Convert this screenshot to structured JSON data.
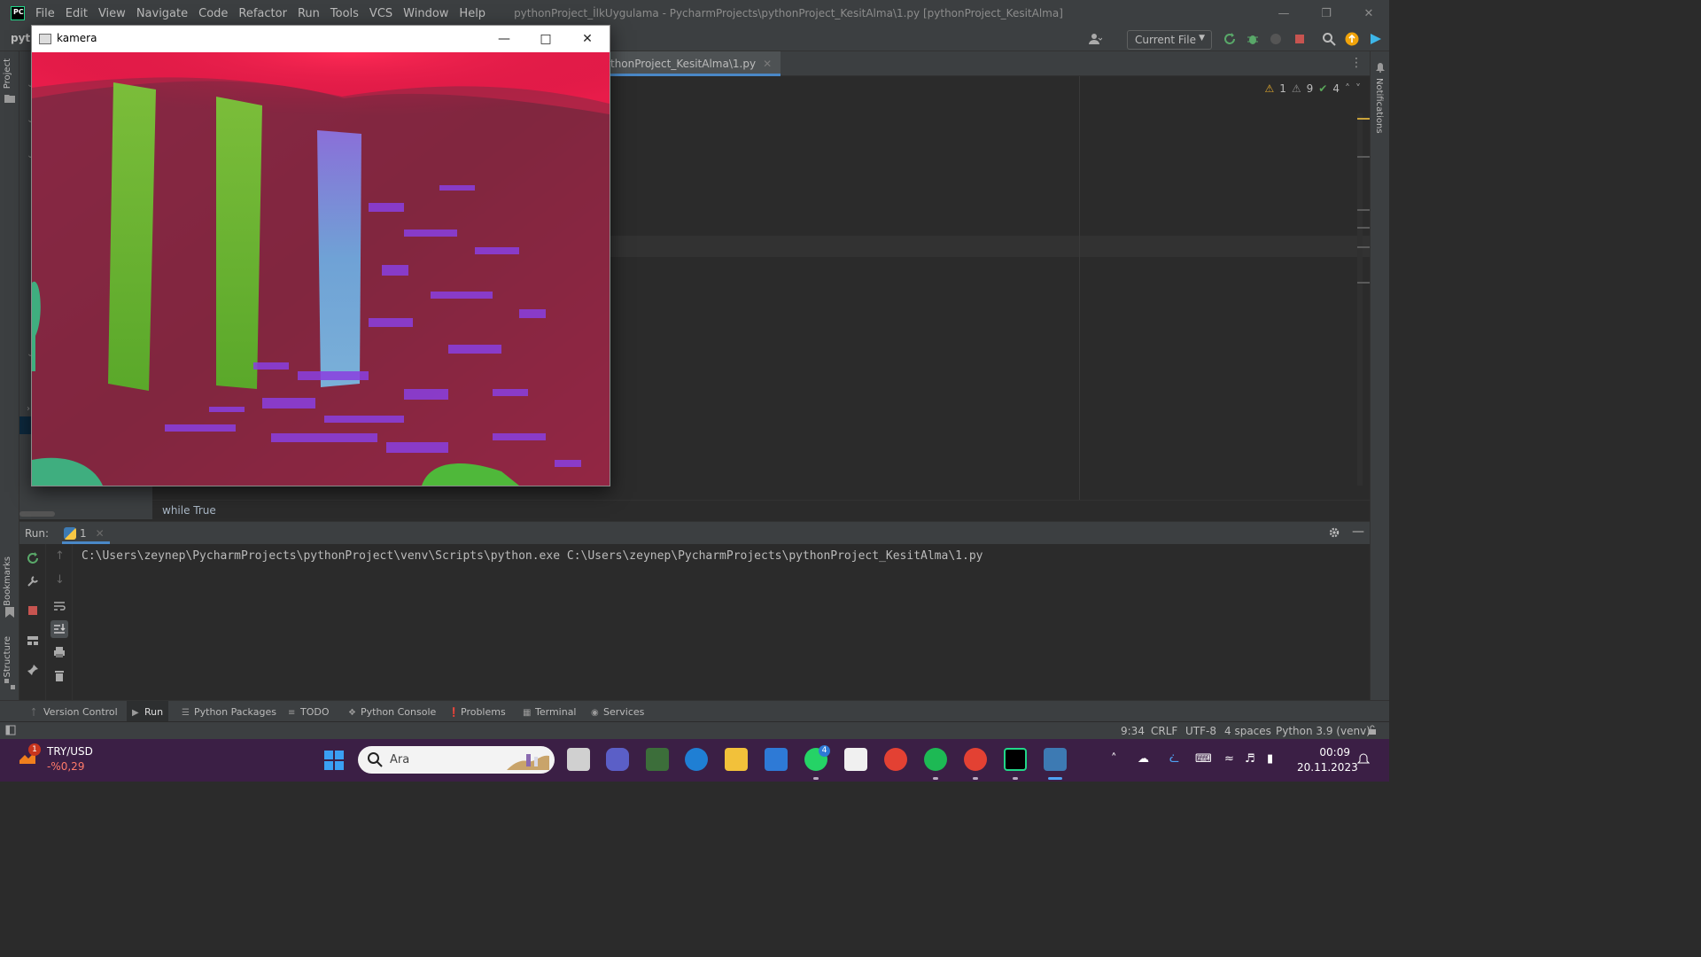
{
  "menu": [
    "File",
    "Edit",
    "View",
    "Navigate",
    "Code",
    "Refactor",
    "Run",
    "Tools",
    "VCS",
    "Window",
    "Help"
  ],
  "window_title": "pythonProject_İlkUygulama - PycharmProjects\\pythonProject_KesitAlma\\1.py [pythonProject_KesitAlma]",
  "project_crumb": "pyth",
  "run_config": "Current File",
  "left_strip": {
    "project": "Project",
    "bookmarks": "Bookmarks",
    "structure": "Structure"
  },
  "right_strip": {
    "notifications": "Notifications"
  },
  "editor": {
    "active_tab": "thonProject_KesitAlma\\1.py",
    "inspections": {
      "warnings": "1",
      "weak_warnings": "9",
      "ok": "4"
    },
    "breadcrumb": "while True"
  },
  "run_panel": {
    "label": "Run:",
    "tab": "1",
    "console": "C:\\Users\\zeynep\\PycharmProjects\\pythonProject\\venv\\Scripts\\python.exe C:\\Users\\zeynep\\PycharmProjects\\pythonProject_KesitAlma\\1.py"
  },
  "tool_tabs": [
    {
      "label": "Version Control",
      "icon": "branch-icon"
    },
    {
      "label": "Run",
      "icon": "play-icon"
    },
    {
      "label": "Python Packages",
      "icon": "layers-icon"
    },
    {
      "label": "TODO",
      "icon": "list-icon"
    },
    {
      "label": "Python Console",
      "icon": "python-icon"
    },
    {
      "label": "Problems",
      "icon": "info-icon"
    },
    {
      "label": "Terminal",
      "icon": "terminal-icon"
    },
    {
      "label": "Services",
      "icon": "play-circle-icon"
    }
  ],
  "status": {
    "position": "9:34",
    "line_sep": "CRLF",
    "encoding": "UTF-8",
    "indent": "4 spaces",
    "interpreter": "Python 3.9 (venv)"
  },
  "camera_window": {
    "title": "kamera"
  },
  "taskbar": {
    "ticker_name": "TRY/USD",
    "ticker_change": "-%0,29",
    "ticker_badge": "1",
    "search_placeholder": "Ara",
    "whatsapp_badge": "4",
    "time": "00:09",
    "date": "20.11.2023"
  },
  "colors": {
    "accent": "#4a88c7",
    "ide_bg": "#2b2b2b",
    "panel_bg": "#3c3f41",
    "taskbar": "#3b1f45"
  }
}
